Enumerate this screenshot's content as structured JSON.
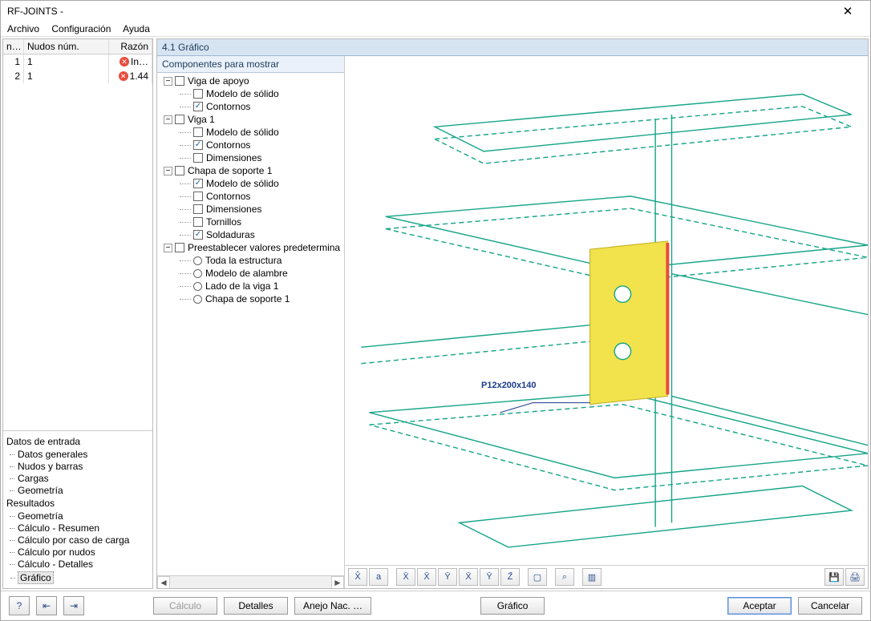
{
  "window": {
    "title": "RF-JOINTS -"
  },
  "menu": {
    "file": "Archivo",
    "config": "Configuración",
    "help": "Ayuda"
  },
  "grid": {
    "h1": "n…",
    "h2": "Nudos núm.",
    "h3": "Razón",
    "rows": [
      {
        "n": "1",
        "node": "1",
        "ratio": "In…"
      },
      {
        "n": "2",
        "node": "1",
        "ratio": "1.44"
      }
    ]
  },
  "nav": {
    "input_h": "Datos de entrada",
    "general": "Datos generales",
    "nodesbars": "Nudos y barras",
    "loads": "Cargas",
    "geom_in": "Geometría",
    "results_h": "Resultados",
    "geom_res": "Geometría",
    "calc_summary": "Cálculo - Resumen",
    "calc_loadcase": "Cálculo por caso de carga",
    "calc_nodes": "Cálculo por nudos",
    "calc_details": "Cálculo - Detalles",
    "graphic": "Gráfico"
  },
  "tab": {
    "title": "4.1 Gráfico"
  },
  "tree": {
    "title": "Componentes para mostrar",
    "support_beam": "Viga de apoyo",
    "solid_model": "Modelo de sólido",
    "contours": "Contornos",
    "beam1": "Viga 1",
    "dimensions": "Dimensiones",
    "plate1": "Chapa de soporte 1",
    "bolts": "Tornillos",
    "welds": "Soldaduras",
    "presets": "Preestablecer valores predetermina",
    "all_struct": "Toda la estructura",
    "wire": "Modelo de alambre",
    "beam1side": "Lado de la viga 1",
    "plate1side": "Chapa de soporte 1"
  },
  "canvas": {
    "plate_label": "P12x200x140"
  },
  "view_toolbar": {
    "iso": "X̂",
    "text": "a",
    "xy": "X̄",
    "xz": "X̄",
    "yz": "Ȳ",
    "xy2": "X̄",
    "yz2": "Ȳ",
    "z": "Z̄",
    "box": "▢",
    "zoom": "⌕",
    "layers": "▥",
    "save": "💾",
    "print": "🖨"
  },
  "bottom": {
    "help_icon": "?",
    "prev_icon": "⇤",
    "next_icon": "⇥",
    "calc": "Cálculo",
    "details": "Detalles",
    "annex": "Anejo Nac. …",
    "graphic": "Gráfico",
    "ok": "Aceptar",
    "cancel": "Cancelar"
  }
}
